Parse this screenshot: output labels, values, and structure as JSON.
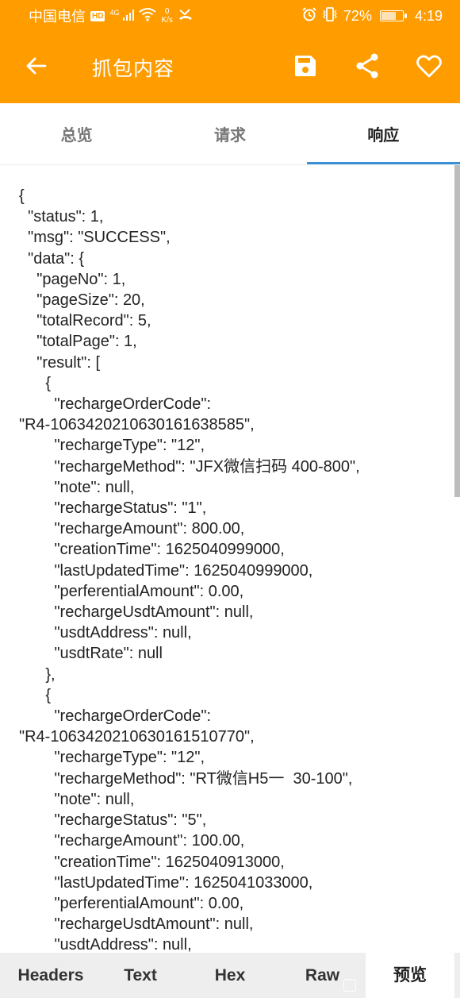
{
  "status_bar": {
    "carrier": "中国电信",
    "hd_label": "HD",
    "network_type": "4G",
    "net_speed_value": "0",
    "net_speed_unit": "K/s",
    "battery_percent": "72%",
    "battery_level": 0.72,
    "time": "4:19"
  },
  "app_bar": {
    "title": "抓包内容",
    "back_icon": "arrow-left-icon",
    "actions": [
      {
        "name": "save",
        "icon": "floppy-disk-icon"
      },
      {
        "name": "share",
        "icon": "share-icon"
      },
      {
        "name": "favorite",
        "icon": "heart-outline-icon"
      }
    ]
  },
  "tabs": [
    {
      "label": "总览",
      "active": false
    },
    {
      "label": "请求",
      "active": false
    },
    {
      "label": "响应",
      "active": true
    }
  ],
  "colors": {
    "accent": "#FF9D00",
    "tab_indicator": "#3A8FD9",
    "bottom_bar": "#EEEEEE"
  },
  "response_body_lines": [
    "{",
    "  \"status\": 1,",
    "  \"msg\": \"SUCCESS\",",
    "  \"data\": {",
    "    \"pageNo\": 1,",
    "    \"pageSize\": 20,",
    "    \"totalRecord\": 5,",
    "    \"totalPage\": 1,",
    "    \"result\": [",
    "      {",
    "        \"rechargeOrderCode\":",
    "\"R4-1063420210630161638585\",",
    "        \"rechargeType\": \"12\",",
    "        \"rechargeMethod\": \"JFX微信扫码 400-800\",",
    "        \"note\": null,",
    "        \"rechargeStatus\": \"1\",",
    "        \"rechargeAmount\": 800.00,",
    "        \"creationTime\": 1625040999000,",
    "        \"lastUpdatedTime\": 1625040999000,",
    "        \"perferentialAmount\": 0.00,",
    "        \"rechargeUsdtAmount\": null,",
    "        \"usdtAddress\": null,",
    "        \"usdtRate\": null",
    "      },",
    "      {",
    "        \"rechargeOrderCode\":",
    "\"R4-1063420210630161510770\",",
    "        \"rechargeType\": \"12\",",
    "        \"rechargeMethod\": \"RT微信H5一  30-100\",",
    "        \"note\": null,",
    "        \"rechargeStatus\": \"5\",",
    "        \"rechargeAmount\": 100.00,",
    "        \"creationTime\": 1625040913000,",
    "        \"lastUpdatedTime\": 1625041033000,",
    "        \"perferentialAmount\": 0.00,",
    "        \"rechargeUsdtAmount\": null,",
    "        \"usdtAddress\": null,"
  ],
  "bottom_tabs": [
    {
      "label": "Headers",
      "active": false
    },
    {
      "label": "Text",
      "active": false
    },
    {
      "label": "Hex",
      "active": false
    },
    {
      "label": "Raw",
      "active": false
    },
    {
      "label": "预览",
      "active": true
    }
  ]
}
